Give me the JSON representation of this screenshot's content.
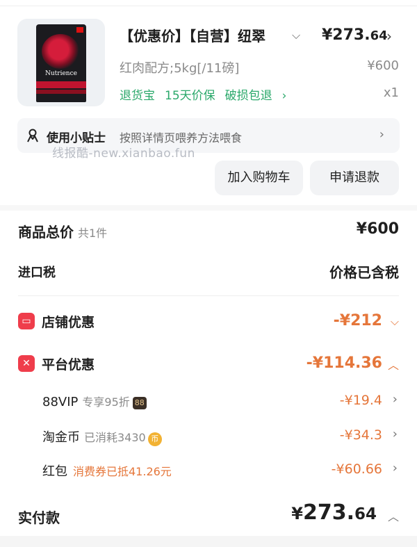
{
  "product": {
    "title": "【优惠价】【自营】纽翠",
    "image_brand": "Nutrience",
    "price_main": "¥273.",
    "price_decimal": "64",
    "spec": "红肉配方;5kg[/11磅]",
    "original_price": "¥600",
    "services": [
      "退货宝",
      "15天价保",
      "破损包退"
    ],
    "quantity": "x1"
  },
  "tip": {
    "label": "使用小贴士",
    "text": "按照详情页喂养方法喂食"
  },
  "watermark": "线报酷-new.xianbao.fun",
  "actions": {
    "add_to_cart": "加入购物车",
    "refund": "申请退款"
  },
  "summary": {
    "total_label": "商品总价",
    "total_count": "共1件",
    "total_value": "¥600",
    "tax_label": "进口税",
    "tax_value": "价格已含税"
  },
  "discounts": {
    "store": {
      "label": "店铺优惠",
      "value": "-¥212"
    },
    "platform": {
      "label": "平台优惠",
      "value": "-¥114.36"
    },
    "items": [
      {
        "label": "88VIP",
        "note": "专享95折",
        "badge": "88",
        "value": "-¥19.4"
      },
      {
        "label": "淘金币",
        "note": "已消耗3430",
        "badge": "币",
        "value": "-¥34.3"
      },
      {
        "label": "红包",
        "note": "消费券已抵41.26元",
        "value": "-¥60.66"
      }
    ]
  },
  "payment": {
    "label": "实付款",
    "currency": "¥",
    "value_main": "273.",
    "value_decimal": "64"
  },
  "colors": {
    "discount": "#e5763a",
    "service_green": "#2aa86a",
    "icon_red": "#ef3d4b"
  },
  "icons": {
    "tip": "person-bulb-icon",
    "store": "store-icon",
    "platform": "platform-coupon-icon"
  }
}
